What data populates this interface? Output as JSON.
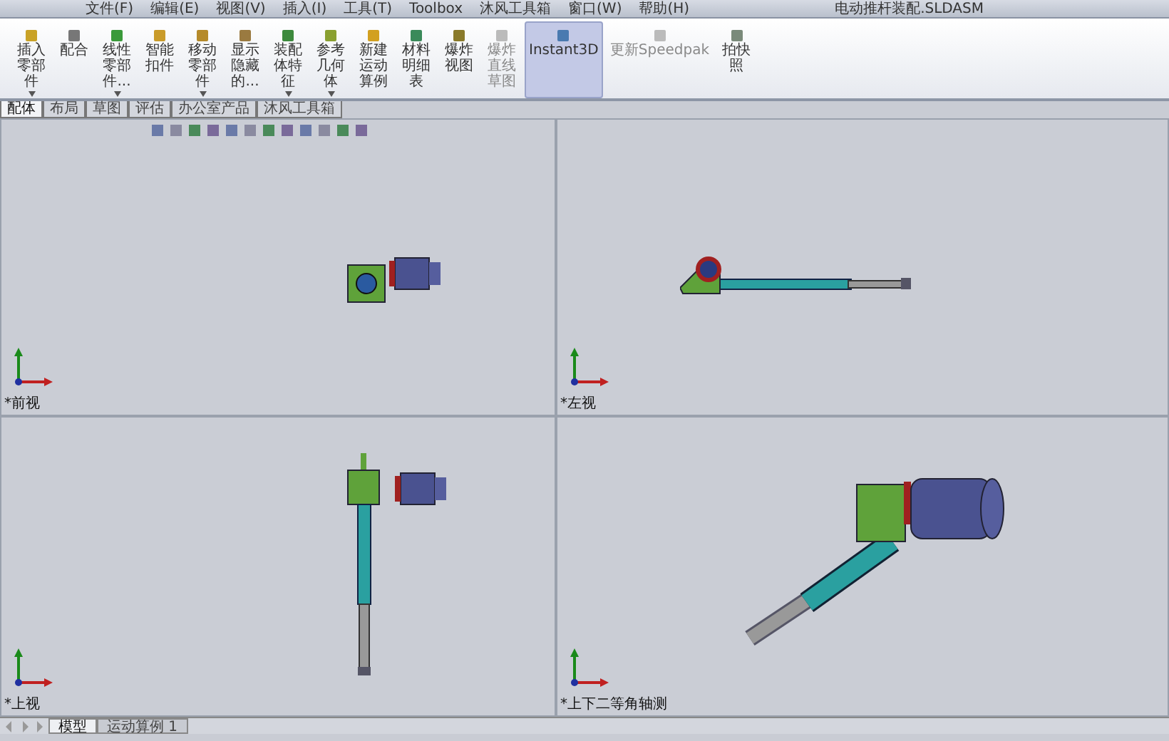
{
  "menu": [
    "文件(F)",
    "编辑(E)",
    "视图(V)",
    "插入(I)",
    "工具(T)",
    "Toolbox",
    "沐风工具箱",
    "窗口(W)",
    "帮助(H)"
  ],
  "document_title": "电动推杆装配.SLDASM",
  "ribbon": [
    {
      "label": "插入零部件",
      "kind": "narrow",
      "dropdown": true,
      "disabled": false,
      "selected": false
    },
    {
      "label": "配合",
      "kind": "narrow",
      "dropdown": false,
      "disabled": false,
      "selected": false
    },
    {
      "label": "线性零部件...",
      "kind": "narrow",
      "dropdown": true,
      "disabled": false,
      "selected": false
    },
    {
      "label": "智能扣件",
      "kind": "narrow",
      "dropdown": false,
      "disabled": false,
      "selected": false
    },
    {
      "label": "移动零部件",
      "kind": "narrow",
      "dropdown": true,
      "disabled": false,
      "selected": false
    },
    {
      "label": "显示隐藏的...",
      "kind": "narrow",
      "dropdown": false,
      "disabled": false,
      "selected": false
    },
    {
      "label": "装配体特征",
      "kind": "narrow",
      "dropdown": true,
      "disabled": false,
      "selected": false
    },
    {
      "label": "参考几何体",
      "kind": "narrow",
      "dropdown": true,
      "disabled": false,
      "selected": false
    },
    {
      "label": "新建运动算例",
      "kind": "narrow",
      "dropdown": false,
      "disabled": false,
      "selected": false
    },
    {
      "label": "材料明细表",
      "kind": "narrow",
      "dropdown": false,
      "disabled": false,
      "selected": false
    },
    {
      "label": "爆炸视图",
      "kind": "narrow",
      "dropdown": false,
      "disabled": false,
      "selected": false
    },
    {
      "label": "爆炸直线草图",
      "kind": "narrow",
      "dropdown": false,
      "disabled": true,
      "selected": false
    },
    {
      "label": "Instant3D",
      "kind": "wide",
      "dropdown": false,
      "disabled": false,
      "selected": true
    },
    {
      "label": "更新Speedpak",
      "kind": "wide",
      "dropdown": false,
      "disabled": true,
      "selected": false
    },
    {
      "label": "拍快照",
      "kind": "narrow",
      "dropdown": false,
      "disabled": false,
      "selected": false
    }
  ],
  "tabs": [
    {
      "label": "配体",
      "selected": true
    },
    {
      "label": "布局",
      "selected": false
    },
    {
      "label": "草图",
      "selected": false
    },
    {
      "label": "评估",
      "selected": false
    },
    {
      "label": "办公室产品",
      "selected": false
    },
    {
      "label": "沐风工具箱",
      "selected": false
    }
  ],
  "viewports": [
    {
      "label": "*前视",
      "kind": "front"
    },
    {
      "label": "*左视",
      "kind": "left"
    },
    {
      "label": "*上视",
      "kind": "top"
    },
    {
      "label": "*上下二等角轴测",
      "kind": "iso"
    }
  ],
  "bottom_tabs": [
    {
      "label": "模型",
      "selected": true
    },
    {
      "label": "运动算例 1",
      "selected": false
    }
  ]
}
